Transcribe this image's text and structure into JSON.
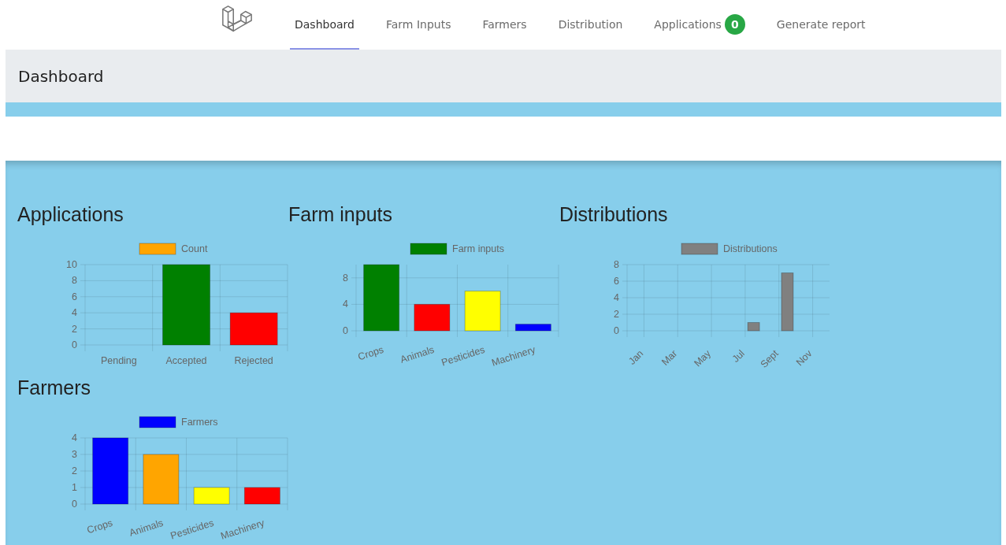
{
  "nav": {
    "items": [
      {
        "label": "Dashboard",
        "selected": true
      },
      {
        "label": "Farm Inputs",
        "selected": false
      },
      {
        "label": "Farmers",
        "selected": false
      },
      {
        "label": "Distribution",
        "selected": false
      },
      {
        "label": "Applications",
        "selected": false,
        "badge": "0"
      },
      {
        "label": "Generate report",
        "selected": false
      }
    ]
  },
  "header": {
    "title": "Dashboard"
  },
  "sections": [
    {
      "title": "Applications",
      "chart_data": {
        "type": "bar",
        "grid": true,
        "categories": [
          "Pending",
          "Accepted",
          "Rejected"
        ],
        "series": [
          {
            "name": "Count",
            "color": "#ffa500",
            "colors": [
              "#ffa500",
              "#008000",
              "#ff0000"
            ],
            "values": [
              0,
              10,
              4
            ]
          }
        ],
        "ylim": [
          0,
          10
        ],
        "yticks": [
          0,
          2,
          4,
          6,
          8,
          10
        ]
      }
    },
    {
      "title": "Farm inputs",
      "chart_data": {
        "type": "bar",
        "grid": true,
        "categories": [
          "Crops",
          "Animals",
          "Pesticides",
          "Machinery"
        ],
        "series": [
          {
            "name": "Farm inputs",
            "color": "#008000",
            "colors": [
              "#008000",
              "#ff0000",
              "#ffff00",
              "#0000ff"
            ],
            "values": [
              10,
              4,
              6,
              1
            ]
          }
        ],
        "ylim": [
          0,
          10
        ],
        "yticks": [
          0,
          4,
          8
        ]
      }
    },
    {
      "title": "Distributions",
      "chart_data": {
        "type": "bar",
        "grid": true,
        "categories": [
          "Jan",
          null,
          "Mar",
          null,
          "May",
          null,
          "Jul",
          null,
          "Sept",
          null,
          "Nov",
          null
        ],
        "series": [
          {
            "name": "Distributions",
            "color": "#808080",
            "values": [
              0,
              0,
              0,
              0,
              0,
              0,
              0,
              1,
              0,
              7,
              0,
              0
            ]
          }
        ],
        "ylim": [
          0,
          8
        ],
        "yticks": [
          0,
          2,
          4,
          6,
          8
        ]
      }
    },
    {
      "title": "Farmers",
      "chart_data": {
        "type": "bar",
        "grid": true,
        "categories": [
          "Crops",
          "Animals",
          "Pesticides",
          "Machinery"
        ],
        "series": [
          {
            "name": "Farmers",
            "color": "#0000ff",
            "colors": [
              "#0000ff",
              "#ffa500",
              "#ffff00",
              "#ff0000"
            ],
            "values": [
              4,
              3,
              1,
              1
            ]
          }
        ],
        "ylim": [
          0,
          4
        ],
        "yticks": [
          0,
          1,
          2,
          3,
          4
        ]
      }
    }
  ]
}
